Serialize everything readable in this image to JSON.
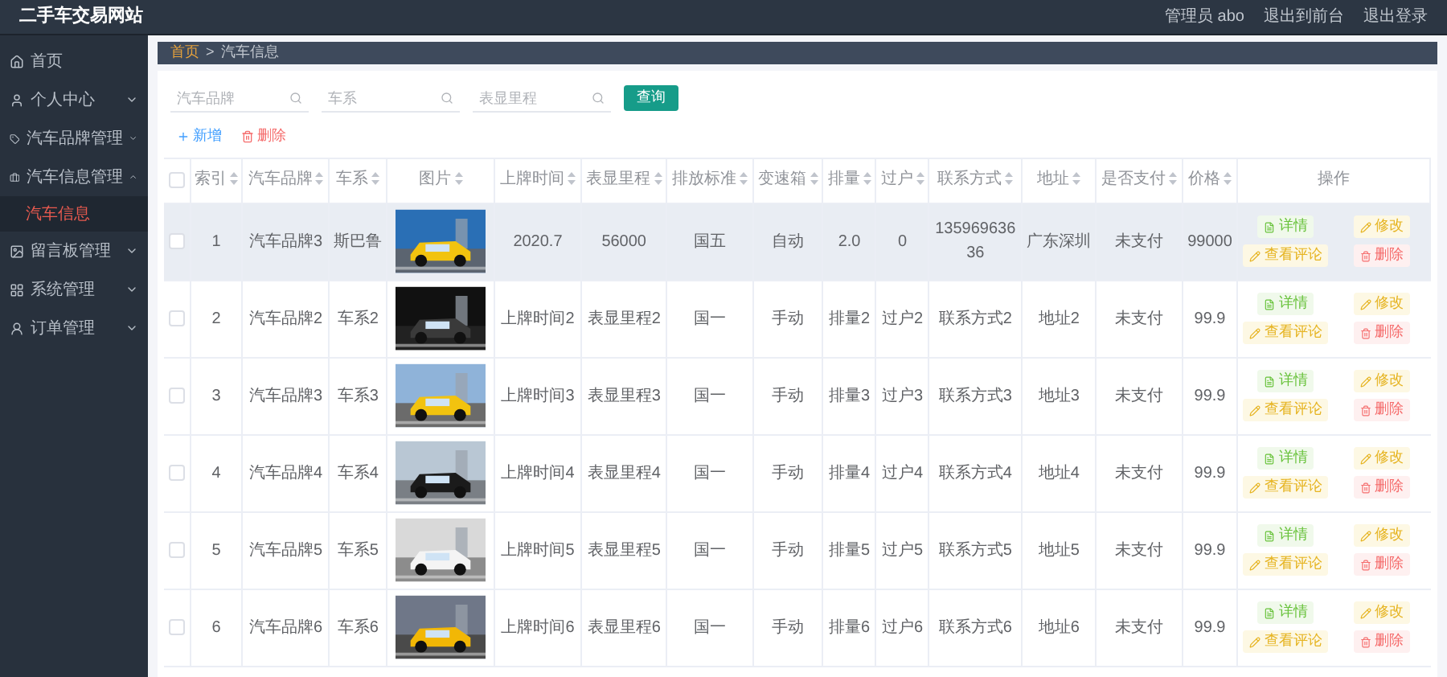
{
  "header": {
    "title": "二手车交易网站",
    "links": [
      "管理员 abo",
      "退出到前台",
      "退出登录"
    ]
  },
  "sidebar": {
    "items": [
      {
        "label": "首页",
        "selected": false
      },
      {
        "label": "个人中心",
        "selected": false,
        "expanded": false
      },
      {
        "label": "汽车品牌管理",
        "selected": false,
        "expanded": false
      },
      {
        "label": "汽车信息管理",
        "selected": false,
        "expanded": true,
        "children": [
          {
            "label": "汽车信息",
            "selected": true
          }
        ]
      },
      {
        "label": "留言板管理",
        "selected": false,
        "expanded": false
      },
      {
        "label": "系统管理",
        "selected": false,
        "expanded": false
      },
      {
        "label": "订单管理",
        "selected": false,
        "expanded": false
      }
    ]
  },
  "breadcrumb": [
    "首页",
    "汽车信息"
  ],
  "breadcrumb_separator": ">",
  "search": {
    "fields": [
      {
        "placeholder": "汽车品牌"
      },
      {
        "placeholder": "车系"
      },
      {
        "placeholder": "表显里程"
      }
    ],
    "button": "查询"
  },
  "actions": [
    {
      "kind": "add",
      "label": "新增"
    },
    {
      "kind": "delete",
      "label": "删除"
    }
  ],
  "table": {
    "select_all_checked": false,
    "columns": [
      {
        "label": "索引",
        "sortable": true
      },
      {
        "label": "汽车品牌",
        "sortable": true
      },
      {
        "label": "车系",
        "sortable": true
      },
      {
        "label": "图片",
        "sortable": true
      },
      {
        "label": "上牌时间",
        "sortable": true
      },
      {
        "label": "表显里程",
        "sortable": true
      },
      {
        "label": "排放标准",
        "sortable": true
      },
      {
        "label": "变速箱",
        "sortable": true
      },
      {
        "label": "排量",
        "sortable": true
      },
      {
        "label": "过户",
        "sortable": true
      },
      {
        "label": "联系方式",
        "sortable": true
      },
      {
        "label": "地址",
        "sortable": true
      },
      {
        "label": "是否支付",
        "sortable": true
      },
      {
        "label": "价格",
        "sortable": true
      },
      {
        "label": "操作",
        "sortable": false
      }
    ],
    "rows": [
      {
        "checked": false,
        "highlighted": true,
        "cells": [
          "1",
          "汽车品牌3",
          "斯巴鲁",
          {
            "kind": "picture"
          },
          "2020.7",
          "56000",
          "国五",
          "自动",
          "2.0",
          "0",
          "13596963636",
          "广东深圳",
          "未支付",
          "99000"
        ],
        "actions": [
          {
            "kind": "detail",
            "label": "详情"
          },
          {
            "kind": "edit",
            "label": "修改"
          },
          {
            "kind": "comments",
            "label": "查看评论"
          },
          {
            "kind": "delete",
            "label": "删除"
          }
        ]
      },
      {
        "checked": false,
        "highlighted": false,
        "cells": [
          "2",
          "汽车品牌2",
          "车系2",
          {
            "kind": "picture"
          },
          "上牌时间2",
          "表显里程2",
          "国一",
          "手动",
          "排量2",
          "过户2",
          "联系方式2",
          "地址2",
          "未支付",
          "99.9"
        ],
        "actions": [
          {
            "kind": "detail",
            "label": "详情"
          },
          {
            "kind": "edit",
            "label": "修改"
          },
          {
            "kind": "comments",
            "label": "查看评论"
          },
          {
            "kind": "delete",
            "label": "删除"
          }
        ]
      },
      {
        "checked": false,
        "highlighted": false,
        "cells": [
          "3",
          "汽车品牌3",
          "车系3",
          {
            "kind": "picture"
          },
          "上牌时间3",
          "表显里程3",
          "国一",
          "手动",
          "排量3",
          "过户3",
          "联系方式3",
          "地址3",
          "未支付",
          "99.9"
        ],
        "actions": [
          {
            "kind": "detail",
            "label": "详情"
          },
          {
            "kind": "edit",
            "label": "修改"
          },
          {
            "kind": "comments",
            "label": "查看评论"
          },
          {
            "kind": "delete",
            "label": "删除"
          }
        ]
      },
      {
        "checked": false,
        "highlighted": false,
        "cells": [
          "4",
          "汽车品牌4",
          "车系4",
          {
            "kind": "picture"
          },
          "上牌时间4",
          "表显里程4",
          "国一",
          "手动",
          "排量4",
          "过户4",
          "联系方式4",
          "地址4",
          "未支付",
          "99.9"
        ],
        "actions": [
          {
            "kind": "detail",
            "label": "详情"
          },
          {
            "kind": "edit",
            "label": "修改"
          },
          {
            "kind": "comments",
            "label": "查看评论"
          },
          {
            "kind": "delete",
            "label": "删除"
          }
        ]
      },
      {
        "checked": false,
        "highlighted": false,
        "cells": [
          "5",
          "汽车品牌5",
          "车系5",
          {
            "kind": "picture"
          },
          "上牌时间5",
          "表显里程5",
          "国一",
          "手动",
          "排量5",
          "过户5",
          "联系方式5",
          "地址5",
          "未支付",
          "99.9"
        ],
        "actions": [
          {
            "kind": "detail",
            "label": "详情"
          },
          {
            "kind": "edit",
            "label": "修改"
          },
          {
            "kind": "comments",
            "label": "查看评论"
          },
          {
            "kind": "delete",
            "label": "删除"
          }
        ]
      },
      {
        "checked": false,
        "highlighted": false,
        "cells": [
          "6",
          "汽车品牌6",
          "车系6",
          {
            "kind": "picture"
          },
          "上牌时间6",
          "表显里程6",
          "国一",
          "手动",
          "排量6",
          "过户6",
          "联系方式6",
          "地址6",
          "未支付",
          "99.9"
        ],
        "actions": [
          {
            "kind": "detail",
            "label": "详情"
          },
          {
            "kind": "edit",
            "label": "修改"
          },
          {
            "kind": "comments",
            "label": "查看评论"
          },
          {
            "kind": "delete",
            "label": "删除"
          }
        ]
      }
    ]
  }
}
